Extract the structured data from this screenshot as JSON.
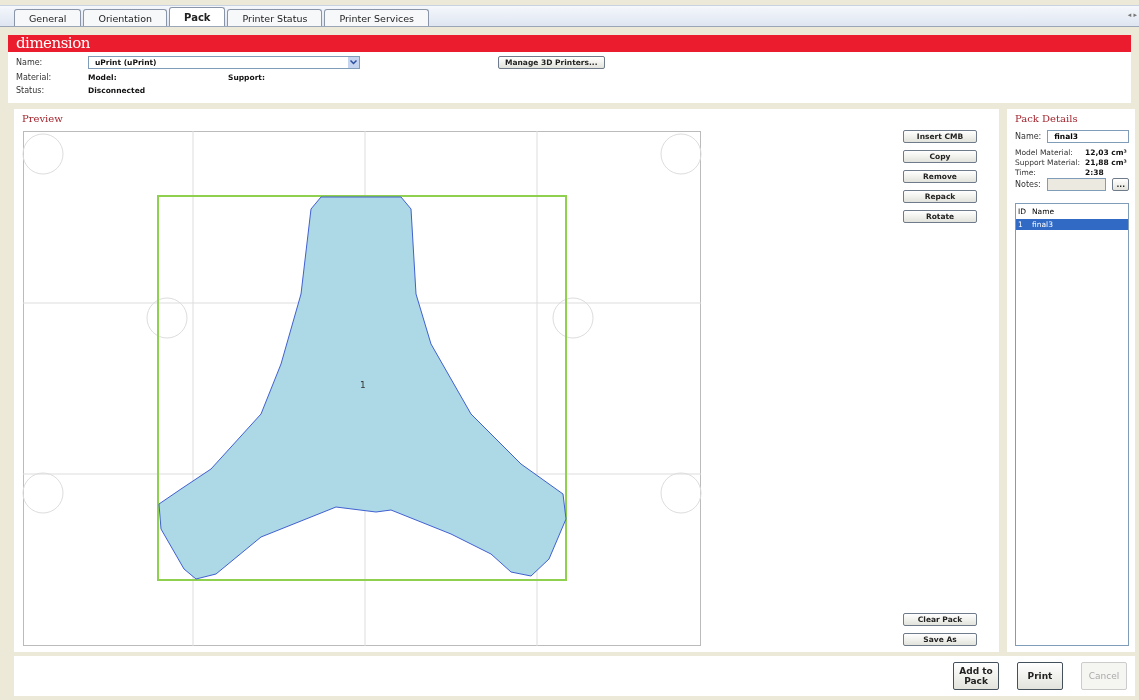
{
  "tabs": [
    {
      "label": "General",
      "selected": false
    },
    {
      "label": "Orientation",
      "selected": false
    },
    {
      "label": "Pack",
      "selected": true
    },
    {
      "label": "Printer Status",
      "selected": false
    },
    {
      "label": "Printer Services",
      "selected": false
    }
  ],
  "tab_scroll": "◂ ▸",
  "brand": "dimension",
  "printer": {
    "name_label": "Name:",
    "name_value": "uPrint  (uPrint)",
    "manage_button": "Manage 3D Printers...",
    "material_label": "Material:",
    "model_label": "Model:",
    "support_label": "Support:",
    "status_label": "Status:",
    "status_value": "Disconnected"
  },
  "preview": {
    "title": "Preview",
    "part_label": "1"
  },
  "actions_top": [
    "Insert CMB",
    "Copy",
    "Remove",
    "Repack",
    "Rotate"
  ],
  "actions_bottom": [
    "Clear Pack",
    "Save As"
  ],
  "pack_details": {
    "title": "Pack Details",
    "name_label": "Name:",
    "name_value": "final3",
    "stats": [
      {
        "label": "Model Material:",
        "value": "12,03 cm³"
      },
      {
        "label": "Support Material:",
        "value": "21,88 cm³"
      },
      {
        "label": "Time:",
        "value": "2:38"
      }
    ],
    "notes_label": "Notes:",
    "notes_button": "...",
    "columns": [
      "ID",
      "Name"
    ],
    "rows": [
      {
        "id": "1",
        "name": "final3",
        "selected": true
      }
    ]
  },
  "footer": [
    {
      "label": "Add to Pack",
      "disabled": false
    },
    {
      "label": "Print",
      "disabled": false
    },
    {
      "label": "Cancel",
      "disabled": true
    }
  ]
}
